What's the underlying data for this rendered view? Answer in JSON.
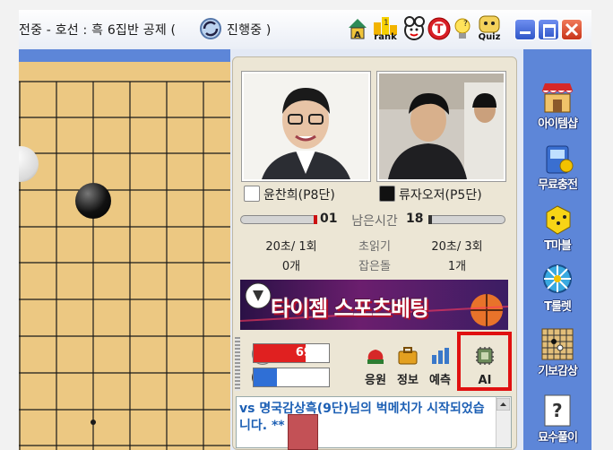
{
  "window": {
    "title": "전중 - 호선 : 흑 6집반 공제 (",
    "title_tail": "진행중 )",
    "toolbar_icons": [
      "rank-icon",
      "mascot-icon",
      "t-coin-icon",
      "lightbulb-icon",
      "quiz-icon"
    ],
    "toolbar_labels": {
      "rank": "rank",
      "quiz": "Quiz"
    }
  },
  "players": {
    "white": {
      "name": "윤찬희(P8단)",
      "rank_time": "01",
      "time": "20초/ 1회",
      "captured": "0개"
    },
    "black": {
      "name": "류자오저(P5단)",
      "rank_time": "18",
      "time": "20초/ 3회",
      "captured": "1개"
    }
  },
  "labels": {
    "remaining_time": "남은시간",
    "byoyomi": "초읽기",
    "captured": "잡은돌"
  },
  "banner": {
    "text": "타이젬 스포츠베팅"
  },
  "win_prob": {
    "white": "69%",
    "black": "31%",
    "white_value": 69,
    "black_value": 31
  },
  "actions": [
    {
      "label": "응원",
      "icon": "cheer-icon"
    },
    {
      "label": "정보",
      "icon": "info-icon"
    },
    {
      "label": "예측",
      "icon": "predict-icon"
    },
    {
      "label": "AI",
      "icon": "ai-chip-icon"
    }
  ],
  "chat": {
    "message": "vs 명국감상흑(9단)님의 벅메치가 시작되었습니다. **"
  },
  "sidebar": [
    {
      "label": "아이템샵",
      "icon": "item-shop-icon"
    },
    {
      "label": "무료충전",
      "icon": "free-charge-icon"
    },
    {
      "label": "T마블",
      "icon": "t-marble-dice-icon"
    },
    {
      "label": "T룰렛",
      "icon": "t-roulette-icon"
    },
    {
      "label": "기보감상",
      "icon": "game-record-icon"
    },
    {
      "label": "묘수풀이",
      "icon": "problem-solving-icon"
    }
  ],
  "colors": {
    "accent": "#5d86d8",
    "ai_highlight": "#e01010",
    "white_bar": "#e02020",
    "black_bar": "#2f6fd6"
  }
}
